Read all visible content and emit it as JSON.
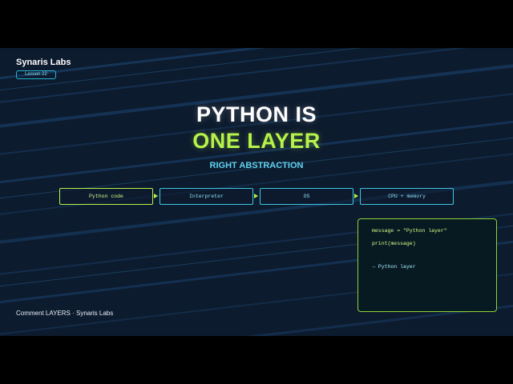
{
  "brand": "Synaris Labs",
  "lesson_badge": "Lesson 22",
  "title_line1": "PYTHON IS",
  "title_line2": "ONE LAYER",
  "subtitle": "RIGHT ABSTRACTION",
  "stack": [
    {
      "label": "Python code",
      "active": true
    },
    {
      "label": "Interpreter",
      "active": false
    },
    {
      "label": "OS",
      "active": false
    },
    {
      "label": "CPU + memory",
      "active": false
    }
  ],
  "code_panel": {
    "line1": "message = \"Python layer\"",
    "line2": "print(message)",
    "output": "→ Python layer"
  },
  "footer": "Comment LAYERS · Synaris Labs",
  "colors": {
    "background": "#0d1b2e",
    "accent_green": "#b6f34a",
    "accent_cyan": "#3ec7e6",
    "title_white": "#ffffff"
  }
}
